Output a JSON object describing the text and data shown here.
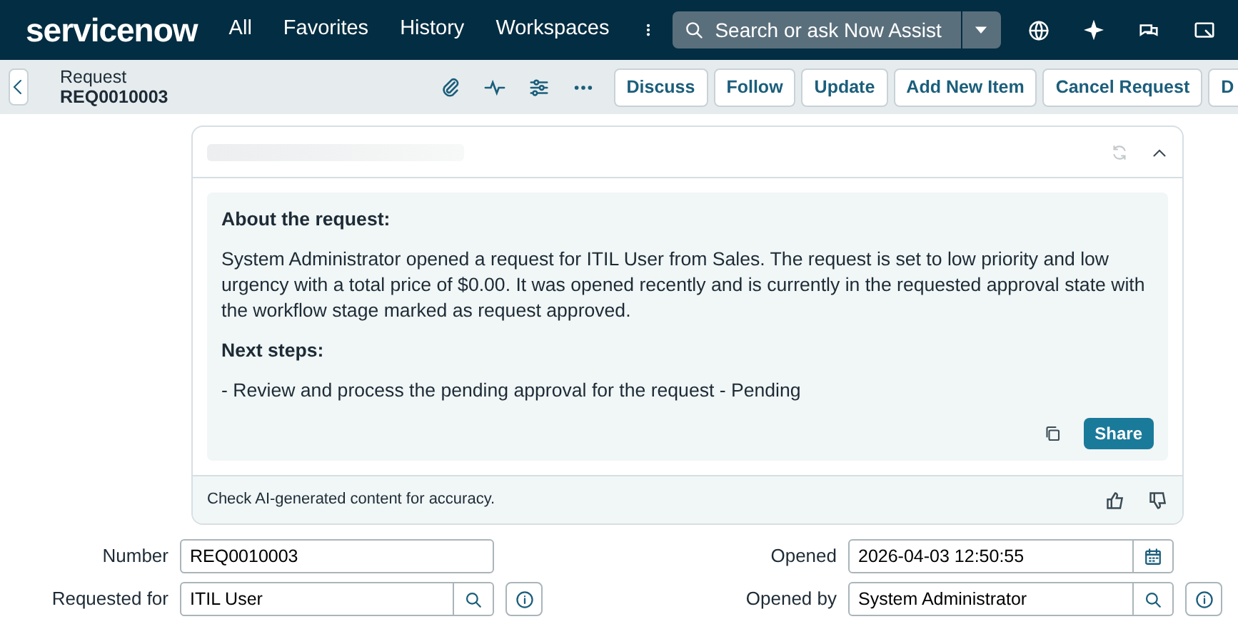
{
  "header": {
    "logo": "servicenow",
    "nav": [
      "All",
      "Favorites",
      "History",
      "Workspaces"
    ],
    "search": {
      "placeholder": "Search or ask Now Assist"
    }
  },
  "record_bar": {
    "type": "Request",
    "number": "REQ0010003",
    "buttons": [
      "Discuss",
      "Follow",
      "Update",
      "Add New Item",
      "Cancel Request",
      "D"
    ]
  },
  "summary_card": {
    "loading": true,
    "expanded": true,
    "heading": "About the request:",
    "body": "System Administrator opened a request for ITIL User from Sales. The request is set to low priority and low urgency with a total price of $0.00. It was opened recently and is currently in the requested approval state with the workflow stage marked as request approved.",
    "next_heading": "Next steps:",
    "next_body": "- Review and process the pending approval for the request - Pending",
    "share": "Share",
    "disclaimer": "Check AI-generated content for accuracy."
  },
  "form": {
    "rows": [
      {
        "left": {
          "label": "Number",
          "value": "REQ0010003",
          "kind": "text"
        },
        "right": {
          "label": "Opened",
          "value": "2026-04-03 12:50:55",
          "kind": "date"
        }
      },
      {
        "left": {
          "label": "Requested for",
          "value": "ITIL User",
          "kind": "reference"
        },
        "right": {
          "label": "Opened by",
          "value": "System Administrator",
          "kind": "reference"
        }
      }
    ]
  }
}
